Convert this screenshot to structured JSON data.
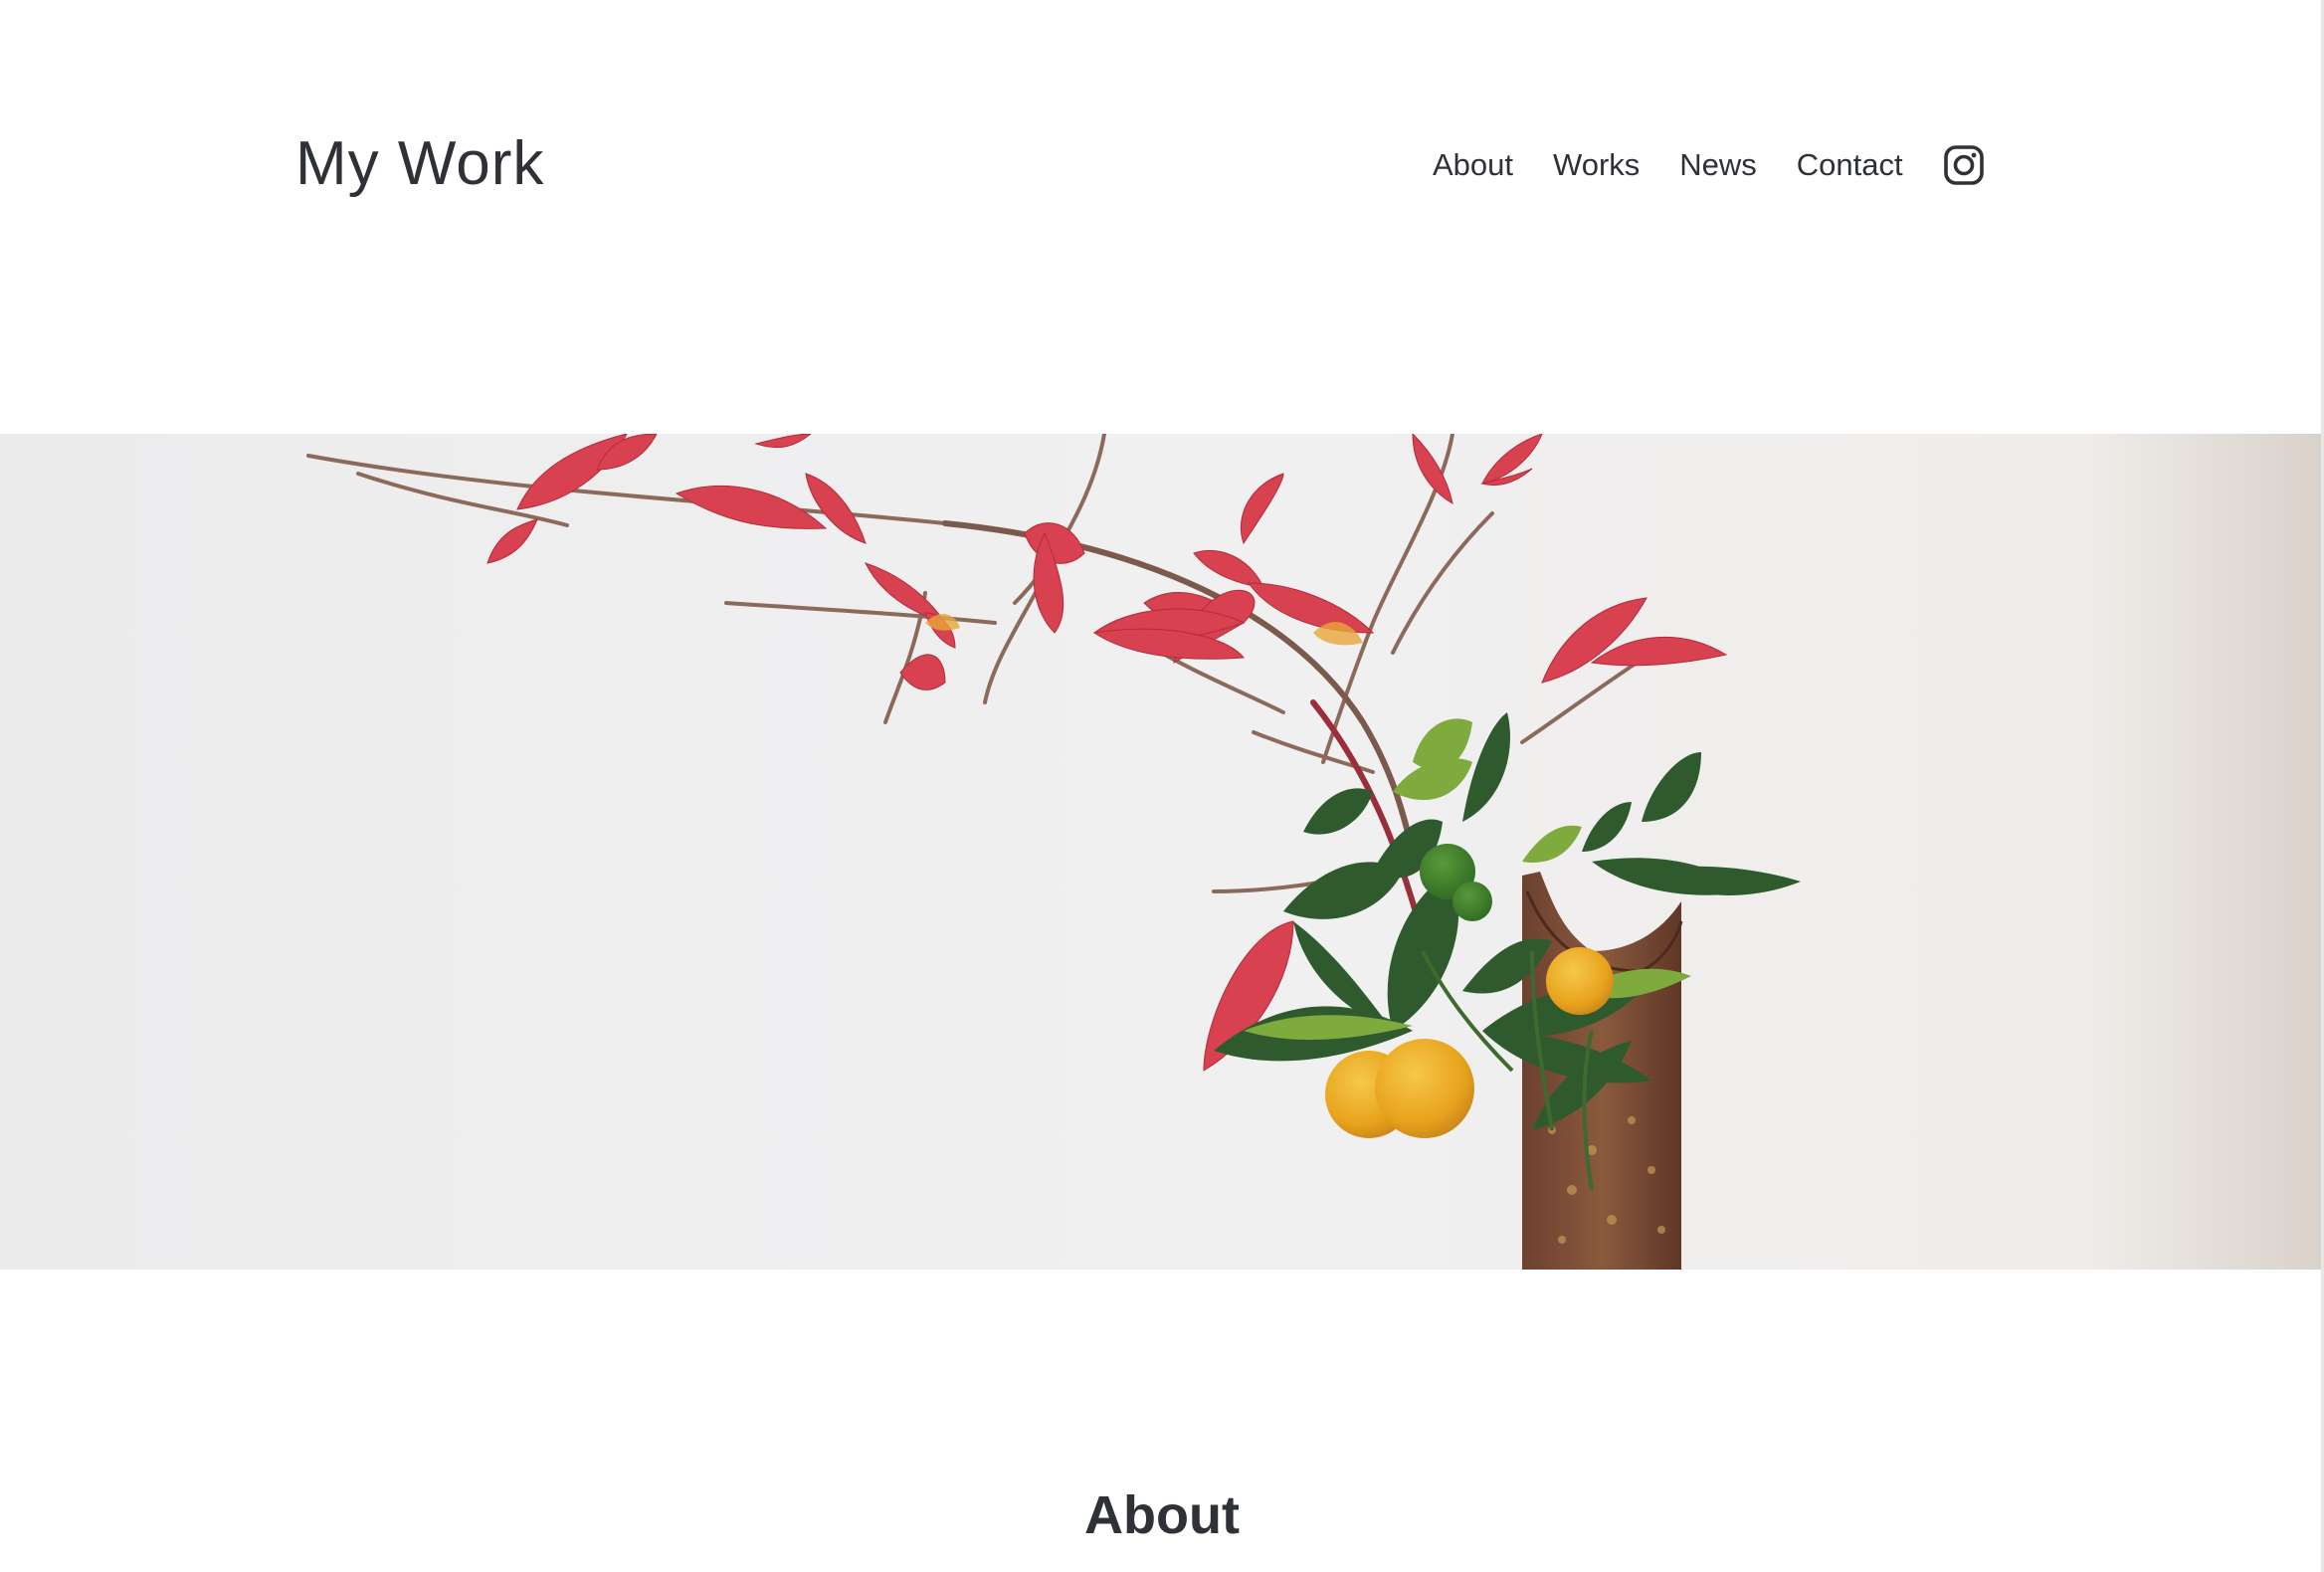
{
  "header": {
    "logo": "My Work",
    "nav": [
      {
        "label": "About"
      },
      {
        "label": "Works"
      },
      {
        "label": "News"
      },
      {
        "label": "Contact"
      }
    ],
    "social_icon": "instagram-icon"
  },
  "hero": {
    "image_subject": "ikebana-arrangement"
  },
  "sections": {
    "about_title": "About"
  },
  "colors": {
    "text": "#2e3136",
    "background": "#ffffff",
    "hero_background": "#efeeee",
    "leaf_red": "#d8414f",
    "leaf_green": "#2f5a2e",
    "citrus": "#e9a91e",
    "vase": "#7a4a33"
  }
}
